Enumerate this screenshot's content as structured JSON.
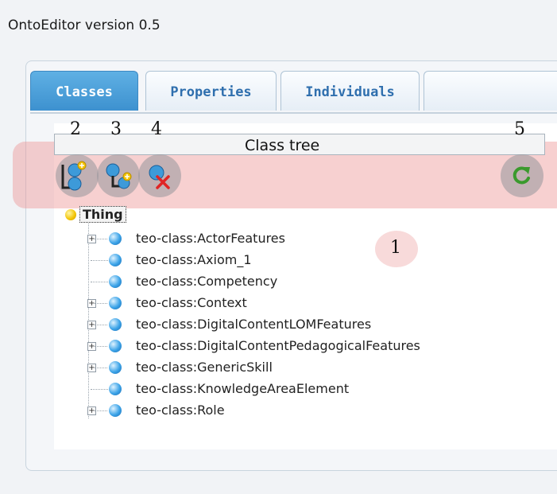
{
  "app": {
    "title": "OntoEditor version 0.5"
  },
  "tabs": [
    {
      "label": "Classes",
      "active": true
    },
    {
      "label": "Properties",
      "active": false
    },
    {
      "label": "Individuals",
      "active": false
    }
  ],
  "tree_panel": {
    "header": "Class tree",
    "toolbar": {
      "buttons": [
        {
          "callout": "2",
          "icon": "add-subclass-icon"
        },
        {
          "callout": "3",
          "icon": "add-sibling-class-icon"
        },
        {
          "callout": "4",
          "icon": "delete-class-icon"
        },
        {
          "callout": "5",
          "icon": "refresh-icon"
        }
      ]
    },
    "area_callout": "1",
    "root": "Thing",
    "items": [
      {
        "label": "teo-class:ActorFeatures",
        "expandable": true
      },
      {
        "label": "teo-class:Axiom_1",
        "expandable": false
      },
      {
        "label": "teo-class:Competency",
        "expandable": false
      },
      {
        "label": "teo-class:Context",
        "expandable": true
      },
      {
        "label": "teo-class:DigitalContentLOMFeatures",
        "expandable": true
      },
      {
        "label": "teo-class:DigitalContentPedagogicalFeatures",
        "expandable": true
      },
      {
        "label": "teo-class:GenericSkill",
        "expandable": true
      },
      {
        "label": "teo-class:KnowledgeAreaElement",
        "expandable": false
      },
      {
        "label": "teo-class:Role",
        "expandable": true
      }
    ]
  },
  "colors": {
    "active_tab": "#4aa0da",
    "tab_text": "#2f6fae",
    "toolbar_highlight": "#ee9696",
    "class_node": "#3ba3e8",
    "root_node": "#f2c300"
  }
}
